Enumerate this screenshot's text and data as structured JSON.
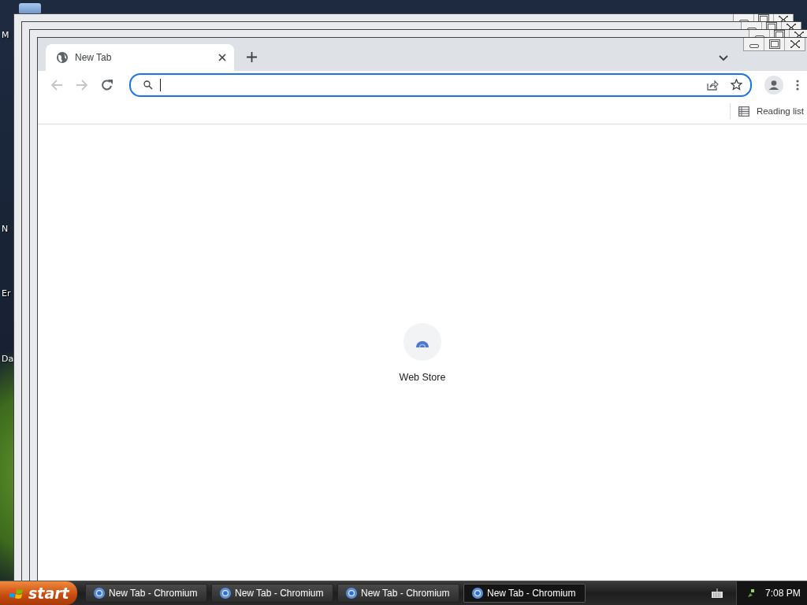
{
  "desktop": {
    "icon_labels": [
      "M",
      "N",
      "Er",
      "Da"
    ]
  },
  "browser": {
    "tabs": [
      {
        "title": "New Tab",
        "selected": true
      }
    ],
    "omnibox": {
      "focused": true
    },
    "bookmarks_bar": {
      "reading_list": "Reading list"
    },
    "shortcuts": [
      {
        "label": "Web Store"
      }
    ]
  },
  "taskbar": {
    "start": "start",
    "tasks": [
      {
        "label": "New Tab - Chromium",
        "selected": false
      },
      {
        "label": "New Tab - Chromium",
        "selected": false
      },
      {
        "label": "New Tab - Chromium",
        "selected": false
      },
      {
        "label": "New Tab - Chromium",
        "selected": true
      }
    ],
    "clock": "7:08 PM"
  }
}
